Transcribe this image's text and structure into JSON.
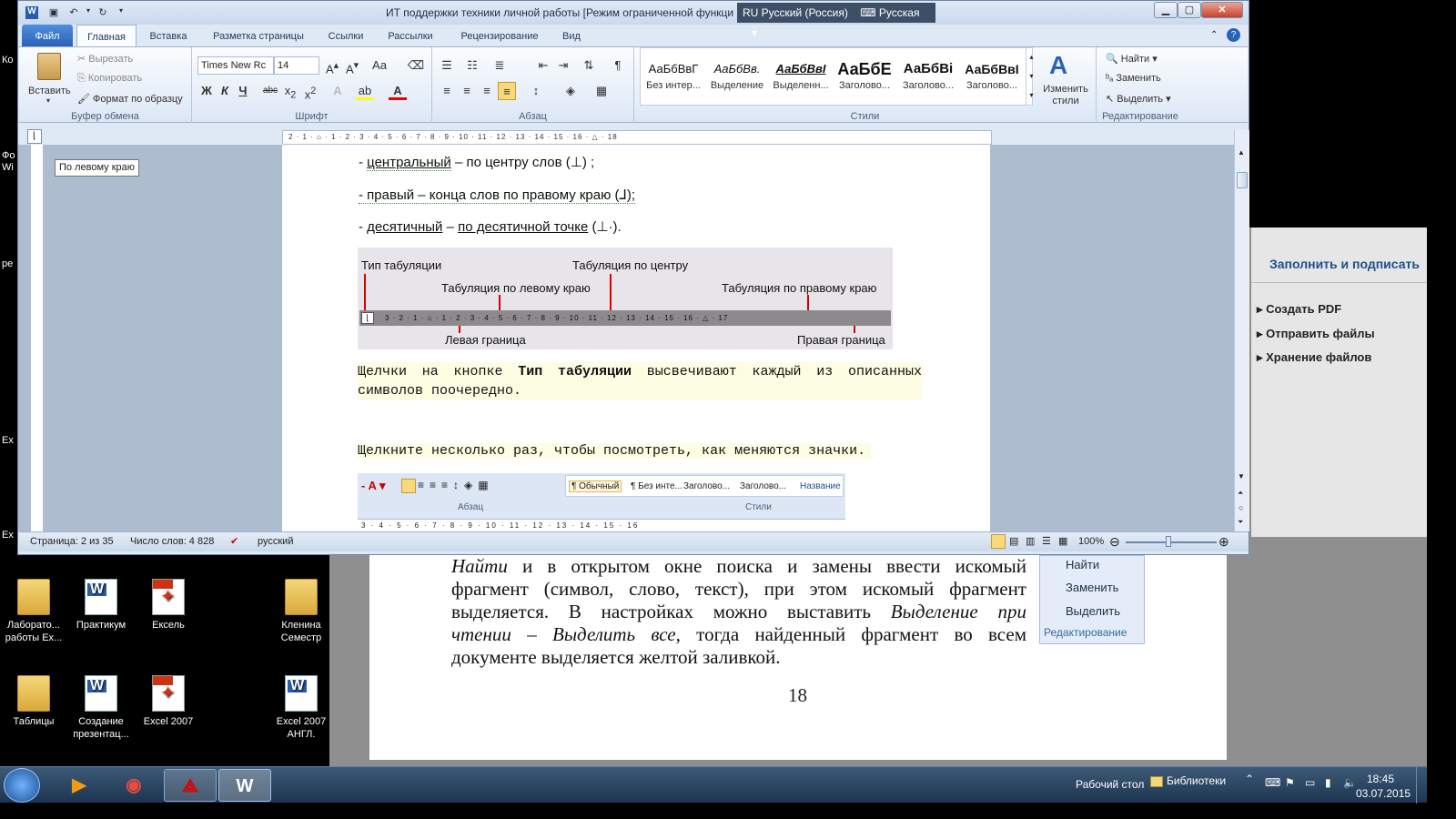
{
  "desktop": {
    "left_labels": [
      "Ко",
      "Фо",
      "Wi",
      "ре",
      "Ex",
      "Ex"
    ],
    "icons": [
      {
        "label": "Лаборато... работы Ex...",
        "kind": "folder"
      },
      {
        "label": "Практикум",
        "kind": "word"
      },
      {
        "label": "Ексель",
        "kind": "pdf"
      },
      {
        "label": "Кленина Семестр",
        "kind": "folder"
      },
      {
        "label": "Таблицы",
        "kind": "folder"
      },
      {
        "label": "Создание презентац...",
        "kind": "word"
      },
      {
        "label": "Excel 2007",
        "kind": "pdf"
      },
      {
        "label": "Excel 2007 АНГЛ.",
        "kind": "word"
      }
    ]
  },
  "background_doc": {
    "lines": [
      {
        "parts": [
          {
            "t": "Найти",
            "i": true
          },
          {
            "t": " и в открытом окне поиска и замены ввести искомый"
          }
        ]
      },
      {
        "parts": [
          {
            "t": "фрагмент (символ, слово, текст), при этом искомый фрагмент"
          }
        ]
      },
      {
        "parts": [
          {
            "t": "выделяется. В настройках можно выставить "
          },
          {
            "t": "Выделение при",
            "i": true
          }
        ]
      },
      {
        "parts": [
          {
            "t": "чтении – Выделить все",
            "i": true
          },
          {
            "t": ", тогда найденный фрагмент во всем"
          }
        ]
      },
      {
        "parts": [
          {
            "t": "документе выделяется желтой заливкой."
          }
        ]
      }
    ],
    "page_number": "18",
    "side_panel": {
      "find": "Найти",
      "replace": "Заменить",
      "select": "Выделить",
      "group": "Редактирование"
    }
  },
  "acrobat": {
    "header": "Заполнить и подписать",
    "items": [
      "Создать PDF",
      "Отправить файлы",
      "Хранение файлов"
    ]
  },
  "word": {
    "title": "ИТ поддержки техники личной работы [Режим ограниченной функци",
    "lang_indicator": "RU Русский (Россия)",
    "lang_kbd": "Русская",
    "tabs": [
      "Файл",
      "Главная",
      "Вставка",
      "Разметка страницы",
      "Ссылки",
      "Рассылки",
      "Рецензирование",
      "Вид"
    ],
    "clipboard": {
      "paste": "Вставить",
      "cut": "Вырезать",
      "copy": "Копировать",
      "format_painter": "Формат по образцу",
      "group": "Буфер обмена"
    },
    "font": {
      "name": "Times New Rc",
      "size": "14",
      "group": "Шрифт"
    },
    "paragraph": {
      "group": "Абзац"
    },
    "styles": {
      "items": [
        {
          "preview": "АаБбВвГ",
          "name": "Без интер..."
        },
        {
          "preview": "АаБбВв.",
          "name": "Выделение"
        },
        {
          "preview": "АаБбВвІ",
          "name": "Выделенн..."
        },
        {
          "preview": "АаБбЕ",
          "name": "Заголово..."
        },
        {
          "preview": "АаБбВі",
          "name": "Заголово..."
        },
        {
          "preview": "АаБбВвІ",
          "name": "Заголово..."
        }
      ],
      "change": "Изменить стили",
      "group": "Стили"
    },
    "editing": {
      "find": "Найти",
      "replace": "Заменить",
      "select": "Выделить",
      "group": "Редактирование"
    },
    "ruler_text": "2 · 1 · ⌂ · 1 · 2 · 3 · 4 · 5 · 6 · 7 · 8 · 9 · 10 · 11 · 12 · 13 · 14 · 15 · 16 · △ · 18",
    "tooltip": "По левому краю",
    "doc": {
      "line1_dash": "- ",
      "line1_term": "центральный",
      "line1_rest": " – по центру слов  (⊥) ;",
      "line2": "- правый – конца слов по правому краю (⅃);",
      "line3_dash": "- ",
      "line3_term": "десятичный",
      "line3_mid": " – ",
      "line3_link": "по десятичной точке",
      "line3_rest": "  (⊥·).",
      "fig1": {
        "tab_type": "Тип табуляции",
        "center": "Табуляция по центру",
        "left": "Табуляция по левому краю",
        "right": "Табуляция по правому краю",
        "left_border": "Левая граница",
        "right_border": "Правая граница",
        "ruler": "3 · 2 · 1 · ⌂ · 1 · 2 · 3 · 4 · 5 · 6 · 7 · 8 · 9 · 10 · 11 · 12 · 13 · 14 · 15 · 16 · △ · 17"
      },
      "para1_a": "Щелчки на кнопке ",
      "para1_b": "Тип табуляции",
      "para1_c": " высвечивают каждый из описанных",
      "para1_d": "символов поочередно.",
      "para2": "Щелкните несколько раз, чтобы посмотреть, как меняются значки.",
      "fig2": {
        "styles": [
          "¶ Обычный",
          "¶ Без инте...",
          "Заголово...",
          "Заголово...",
          "Название"
        ],
        "group_par": "Абзац",
        "group_styles": "Стили",
        "ruler": "3 · 4 · 5 · 6 · 7 · 8 · 9 · 10 · 11 · 12 · 13 · 14 · 15 · 16"
      }
    },
    "status": {
      "page": "Страница: 2 из 35",
      "words": "Число слов: 4 828",
      "lang": "русский",
      "zoom": "100%"
    }
  },
  "taskbar": {
    "desktop_label": "Рабочий стол",
    "libraries": "Библиотеки",
    "time": "18:45",
    "date": "03.07.2015"
  }
}
